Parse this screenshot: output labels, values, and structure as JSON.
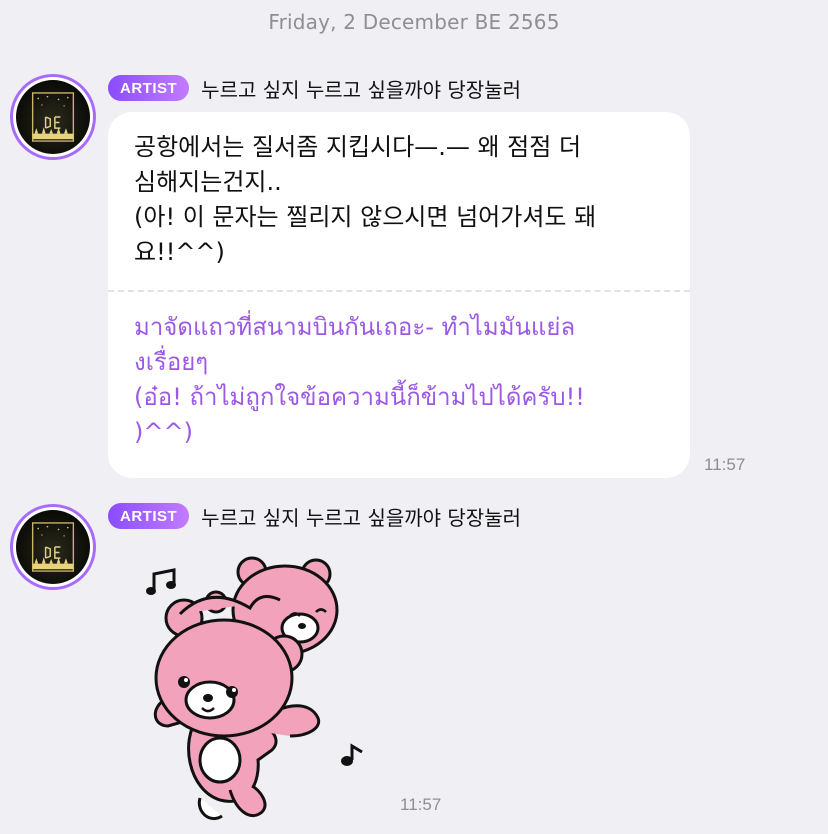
{
  "date_separator": "Friday, 2 December BE 2565",
  "messages": [
    {
      "badge": "ARTIST",
      "sender": "누르고 싶지 누르고 싶을까야 당장눌러",
      "text_original": "공항에서는 질서좀 지킵시다—.— 왜 점점 더\n심해지는건지..\n(아! 이 문자는 찔리지 않으시면 넘어가셔도 돼\n요!!^^)",
      "text_translated": "มาจัดแถวที่สนามบินกันเถอะ- ทำไมมันแย่ล\nงเรื่อยๆ\n(อ๋อ! ถ้าไม่ถูกใจข้อความนี้ก็ข้ามไปได้ครับ!!\n)^^)",
      "time": "11:57"
    },
    {
      "badge": "ARTIST",
      "sender": "누르고 싶지 누르고 싶을까야 당장눌러",
      "sticker": "pink-bears-dancing",
      "time": "11:57"
    }
  ],
  "colors": {
    "background": "#efeff4",
    "badge_start": "#8a4dff",
    "badge_end": "#c27bff",
    "translated_text": "#9b59e6",
    "avatar_ring": "#a86bff",
    "bear_pink": "#f2a3bb"
  }
}
